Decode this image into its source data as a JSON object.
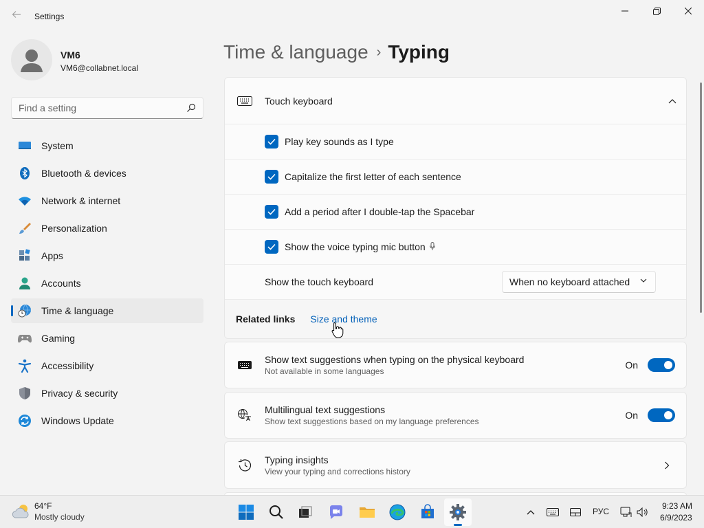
{
  "window": {
    "title": "Settings"
  },
  "profile": {
    "name": "VM6",
    "email": "VM6@collabnet.local"
  },
  "search": {
    "placeholder": "Find a setting"
  },
  "nav": [
    {
      "label": "System",
      "icon": "system-icon"
    },
    {
      "label": "Bluetooth & devices",
      "icon": "bluetooth-icon"
    },
    {
      "label": "Network & internet",
      "icon": "wifi-icon"
    },
    {
      "label": "Personalization",
      "icon": "brush-icon"
    },
    {
      "label": "Apps",
      "icon": "apps-icon"
    },
    {
      "label": "Accounts",
      "icon": "accounts-icon"
    },
    {
      "label": "Time & language",
      "icon": "time-language-icon",
      "active": true
    },
    {
      "label": "Gaming",
      "icon": "gamepad-icon"
    },
    {
      "label": "Accessibility",
      "icon": "accessibility-icon"
    },
    {
      "label": "Privacy & security",
      "icon": "shield-icon"
    },
    {
      "label": "Windows Update",
      "icon": "windows-update-icon"
    }
  ],
  "breadcrumb": {
    "parent": "Time & language",
    "separator": "›",
    "current": "Typing"
  },
  "touch_keyboard": {
    "title": "Touch keyboard",
    "options": [
      {
        "label": "Play key sounds as I type",
        "checked": true
      },
      {
        "label": "Capitalize the first letter of each sentence",
        "checked": true
      },
      {
        "label": "Add a period after I double-tap the Spacebar",
        "checked": true
      },
      {
        "label": "Show the voice typing mic button",
        "checked": true
      }
    ],
    "show_keyboard": {
      "label": "Show the touch keyboard",
      "value": "When no keyboard attached"
    },
    "related_links_label": "Related links",
    "related_link": "Size and theme"
  },
  "text_suggestions": {
    "title": "Show text suggestions when typing on the physical keyboard",
    "desc": "Not available in some languages",
    "state": "On"
  },
  "multilingual": {
    "title": "Multilingual text suggestions",
    "desc": "Show text suggestions based on my language preferences",
    "state": "On"
  },
  "typing_insights": {
    "title": "Typing insights",
    "desc": "View your typing and corrections history"
  },
  "taskbar": {
    "weather_temp": "64°F",
    "weather_cond": "Mostly cloudy",
    "language": "РУС",
    "time": "9:23 AM",
    "date": "6/9/2023"
  },
  "colors": {
    "accent": "#0067c0",
    "link": "#005fb8"
  }
}
